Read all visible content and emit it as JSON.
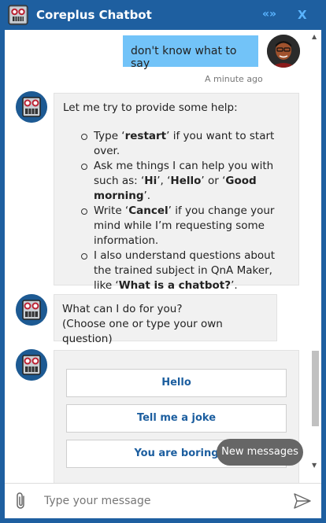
{
  "header": {
    "title": "Coreplus Chatbot",
    "collapse_label": "«»",
    "close_label": "X"
  },
  "messages": {
    "user": {
      "text": "don't know what to say",
      "timestamp": "A minute ago"
    },
    "help": {
      "intro": "Let me try to provide some help:",
      "items": [
        {
          "p1": "Type ‘",
          "b1": "restart",
          "p2": "’ if you want to start over."
        },
        {
          "p1": "Ask me things I can help you with such as: ‘",
          "b1": "Hi",
          "p2": "’, ‘",
          "b2": "Hello",
          "p3": "’ or ‘",
          "b3": "Good morning",
          "p4": "’."
        },
        {
          "p1": "Write ‘",
          "b1": "Cancel",
          "p2": "’ if you change your mind while I’m requesting some information."
        },
        {
          "p1": "I also understand questions about the trained subject in QnA Maker, like ‘",
          "b1": "What is a chatbot?",
          "p2": "’."
        }
      ]
    },
    "ask": {
      "line1": "What can I do for you?",
      "line2": "(Choose one or type your own question)"
    },
    "card_buttons": [
      "Hello",
      "Tell me a joke",
      "You are boring"
    ]
  },
  "toast": "New messages",
  "composer": {
    "placeholder": "Type your message"
  },
  "icons": {
    "attach": "paperclip-icon",
    "send": "send-icon",
    "bot": "robot-avatar"
  },
  "colors": {
    "header_bg": "#1e5fa0",
    "user_bubble": "#72c3f8",
    "card_button_text": "#1c5e9f"
  }
}
